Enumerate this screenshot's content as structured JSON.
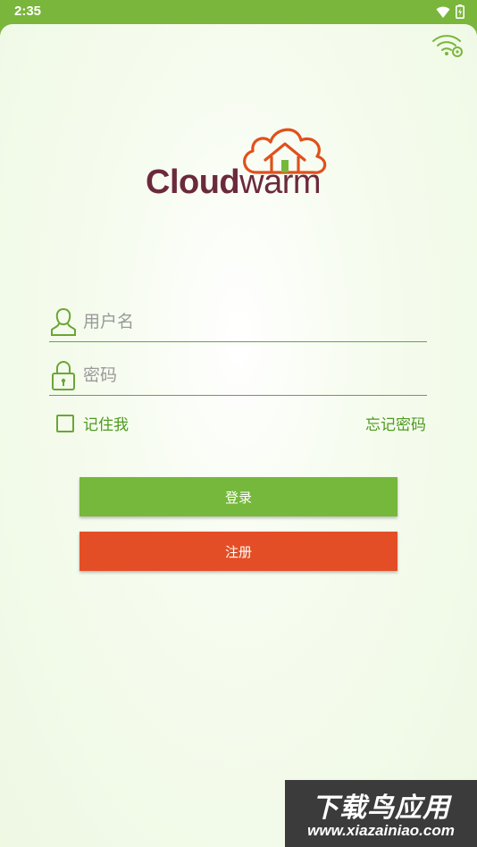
{
  "status_bar": {
    "time": "2:35",
    "icons": [
      "wifi-signal-icon",
      "battery-charging-icon"
    ]
  },
  "header": {
    "icons": [
      "wifi-settings-icon"
    ]
  },
  "logo": {
    "text_bold": "Cloud",
    "text_light": "warm",
    "brand_color": "#6b2a3b",
    "cloud_color": "#e0501d",
    "door_color": "#76b83a"
  },
  "form": {
    "username": {
      "placeholder": "用户名",
      "value": "",
      "icon": "user-icon"
    },
    "password": {
      "placeholder": "密码",
      "value": "",
      "icon": "lock-icon"
    },
    "remember_label": "记住我",
    "remember_checked": false,
    "forgot_label": "忘记密码"
  },
  "buttons": {
    "login_label": "登录",
    "register_label": "注册",
    "login_color": "#75b83b",
    "register_color": "#e44e26"
  },
  "watermark": {
    "title": "下载鸟应用",
    "url": "www.xiazainiao.com"
  },
  "colors": {
    "accent_green": "#79b63b",
    "text_green": "#4e9a20"
  }
}
